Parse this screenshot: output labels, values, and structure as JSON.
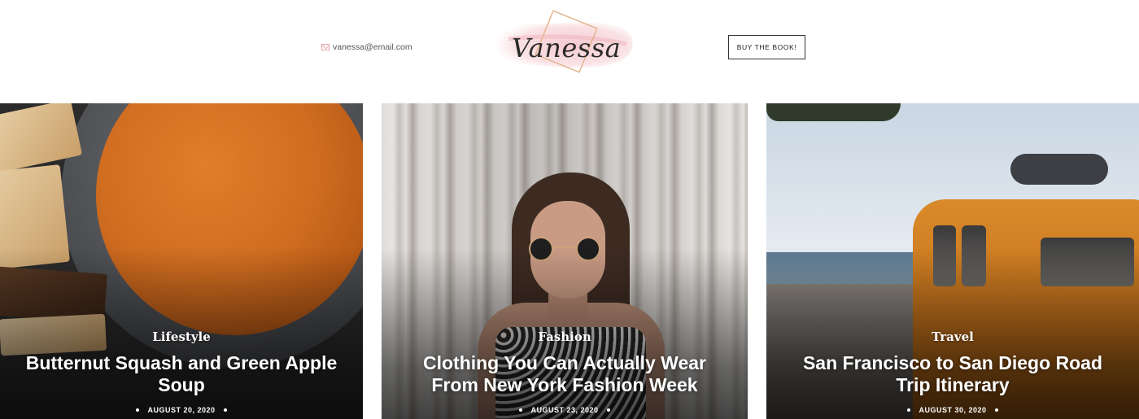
{
  "header": {
    "email": "vanessa@email.com",
    "logo_text": "Vanessa",
    "buy_button_label": "BUY THE BOOK!"
  },
  "posts": [
    {
      "category": "Lifestyle",
      "title": "Butternut Squash and Green Apple Soup",
      "date": "AUGUST 20, 2020"
    },
    {
      "category": "Fashion",
      "title": "Clothing You Can Actually Wear From New York Fashion Week",
      "date": "AUGUST 23, 2020"
    },
    {
      "category": "Travel",
      "title": "San Francisco to San Diego Road Trip Itinerary",
      "date": "AUGUST 30, 2020"
    }
  ],
  "colors": {
    "accent_pink": "#f3c1c6",
    "logo_diamond": "#e7b58a",
    "text_dark": "#222222"
  },
  "icons": {
    "email": "mail-icon"
  }
}
